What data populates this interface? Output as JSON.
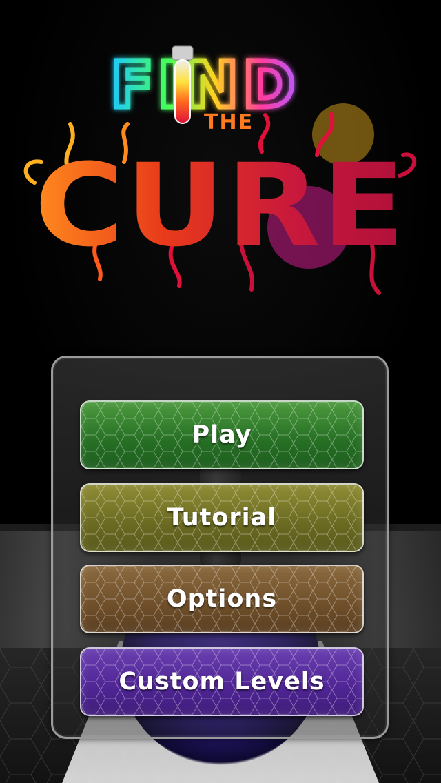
{
  "logo": {
    "word_find": "FIND",
    "word_the": "THE",
    "word_cure": "CURE"
  },
  "menu": {
    "play": "Play",
    "tutorial": "Tutorial",
    "options": "Options",
    "custom_levels": "Custom Levels"
  },
  "colors": {
    "play": "#2f7d2a",
    "tutorial": "#737326",
    "options": "#75542e",
    "custom_levels": "#54299b"
  }
}
